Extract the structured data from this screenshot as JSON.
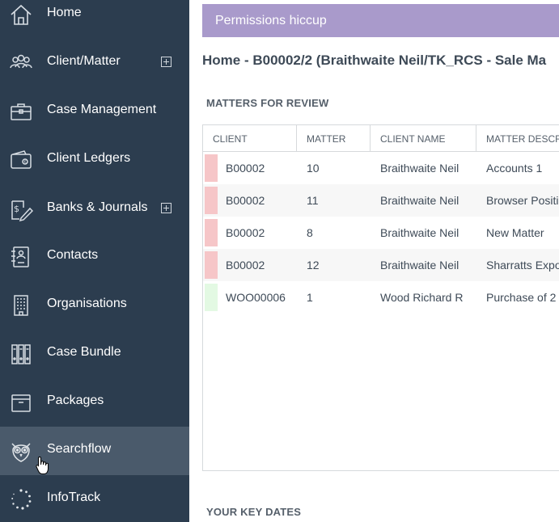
{
  "sidebar": {
    "items": [
      {
        "label": "Home",
        "icon": "home-icon",
        "expandable": false
      },
      {
        "label": "Client/Matter",
        "icon": "users-icon",
        "expandable": true
      },
      {
        "label": "Case Management",
        "icon": "briefcase-icon",
        "expandable": false
      },
      {
        "label": "Client Ledgers",
        "icon": "wallet-icon",
        "expandable": false
      },
      {
        "label": "Banks & Journals",
        "icon": "bank-pen-icon",
        "expandable": true
      },
      {
        "label": "Contacts",
        "icon": "contacts-icon",
        "expandable": false
      },
      {
        "label": "Organisations",
        "icon": "building-icon",
        "expandable": false
      },
      {
        "label": "Case Bundle",
        "icon": "binders-icon",
        "expandable": false
      },
      {
        "label": "Packages",
        "icon": "package-icon",
        "expandable": false
      },
      {
        "label": "Searchflow",
        "icon": "owl-icon",
        "expandable": false,
        "hovered": true
      },
      {
        "label": "InfoTrack",
        "icon": "infotrack-icon",
        "expandable": false
      }
    ]
  },
  "main": {
    "banner": "Permissions hiccup",
    "breadcrumb": "Home - B00002/2 (Braithwaite  Neil/TK_RCS - Sale Ma",
    "matters_title": "MATTERS FOR REVIEW",
    "key_dates_title": "YOUR KEY DATES",
    "columns": [
      "CLIENT",
      "MATTER",
      "CLIENT NAME",
      "MATTER DESCRI"
    ],
    "rows": [
      {
        "client": "B00002",
        "matter": "10",
        "client_name": "Braithwaite Neil",
        "description": "Accounts 1",
        "flag_color": "#f6c6c8"
      },
      {
        "client": "B00002",
        "matter": "11",
        "client_name": "Braithwaite Neil",
        "description": "Browser Positi",
        "flag_color": "#f6c6c8"
      },
      {
        "client": "B00002",
        "matter": "8",
        "client_name": "Braithwaite Neil",
        "description": "New Matter",
        "flag_color": "#f6c6c8"
      },
      {
        "client": "B00002",
        "matter": "12",
        "client_name": "Braithwaite Neil",
        "description": "Sharratts Expo",
        "flag_color": "#f6c6c8"
      },
      {
        "client": "WOO00006",
        "matter": "1",
        "client_name": "Wood Richard R",
        "description": "Purchase of 2",
        "flag_color": "#e3f9e3"
      }
    ]
  },
  "colors": {
    "sidebar_bg": "#2c3d4f",
    "sidebar_hover": "#4a5a6b",
    "banner_bg": "#a99acb",
    "flag_overdue": "#f6c6c8",
    "flag_ok": "#e3f9e3"
  }
}
